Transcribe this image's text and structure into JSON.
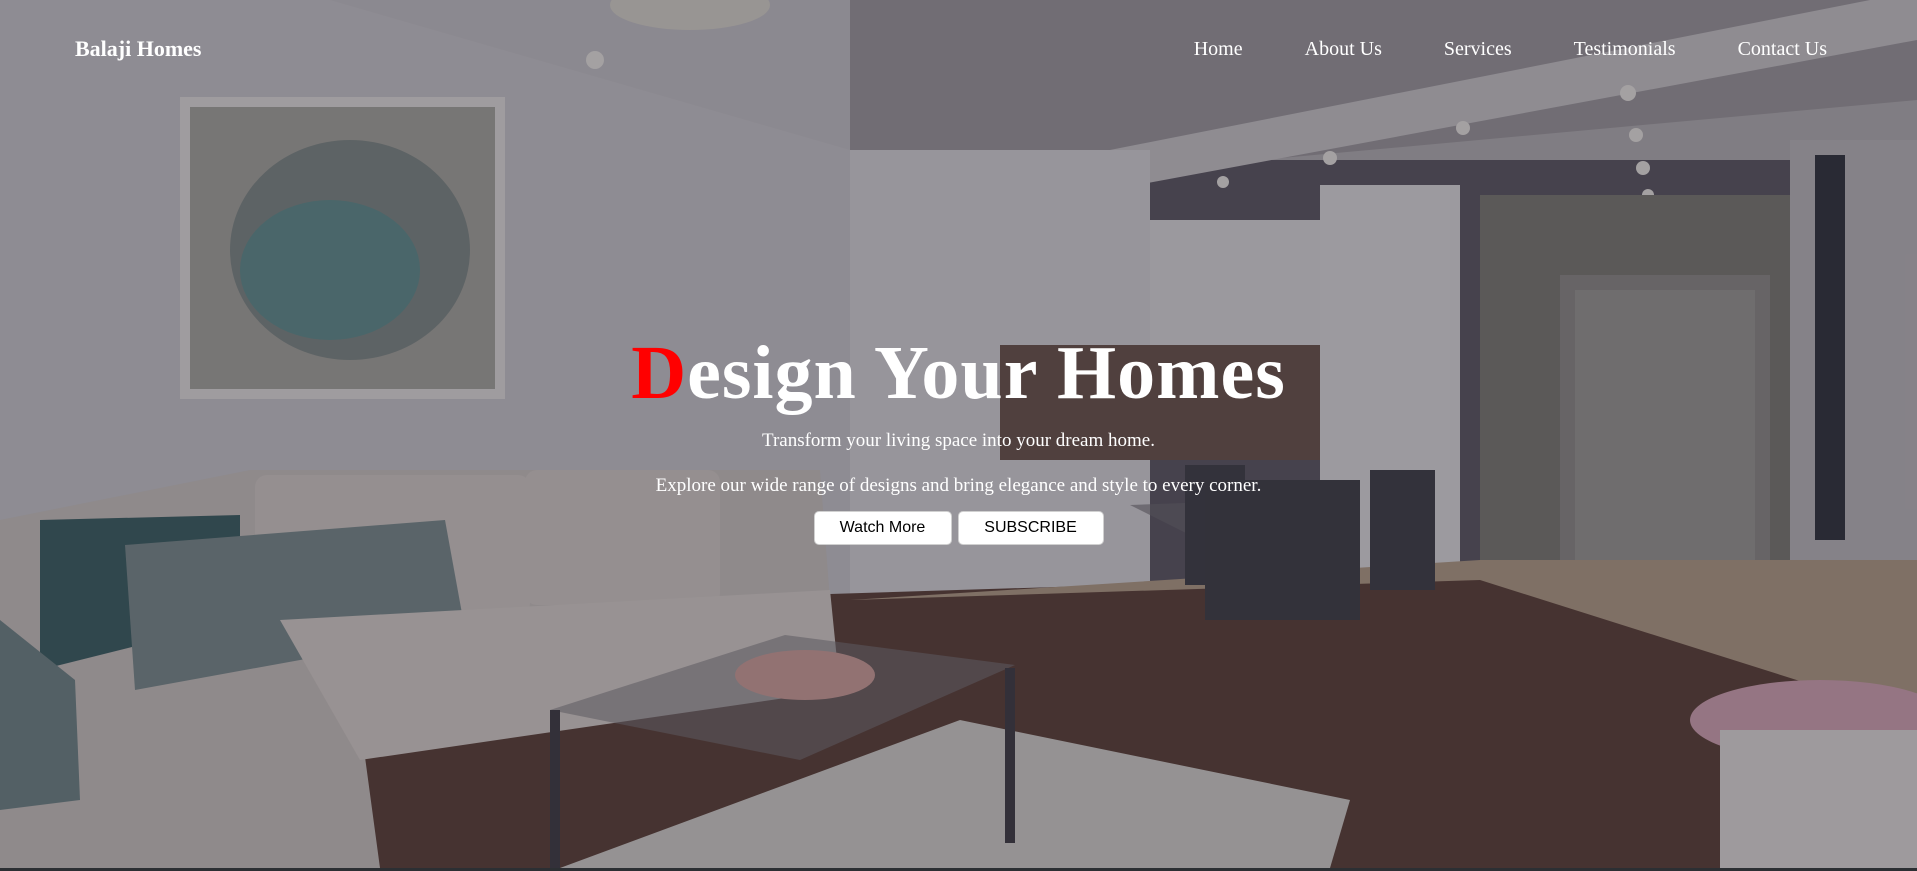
{
  "brand": {
    "name": "Balaji Homes"
  },
  "nav": {
    "items": [
      {
        "label": "Home"
      },
      {
        "label": "About Us"
      },
      {
        "label": "Services"
      },
      {
        "label": "Testimonials"
      },
      {
        "label": "Contact Us"
      }
    ]
  },
  "hero": {
    "title_first_letter": "D",
    "title_rest": "esign Your Homes",
    "subtitle": "Transform your living space into your dream home.",
    "description": "Explore our wide range of designs and bring elegance and style to every corner.",
    "buttons": {
      "watch_label": "Watch More",
      "subscribe_label": "SUBSCRIBE"
    }
  },
  "colors": {
    "accent": "#ff0000",
    "text": "#ffffff",
    "button_bg": "#ffffff"
  }
}
